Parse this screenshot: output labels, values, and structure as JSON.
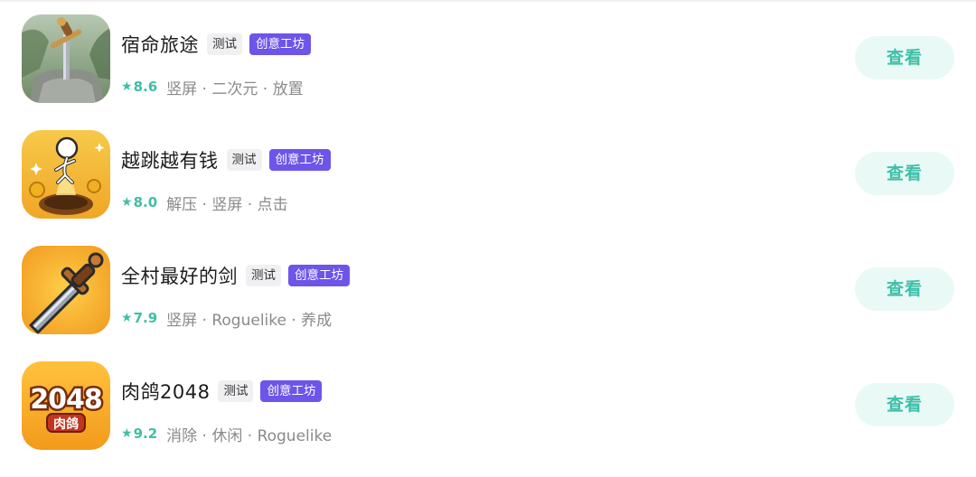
{
  "games": [
    {
      "name": "宿命旅途",
      "test_label": "测试",
      "workshop_label": "创意工坊",
      "rating": "8.6",
      "tags": "竖屏 · 二次元 · 放置",
      "button_label": "查看",
      "icon": "sword-in-stone-icon"
    },
    {
      "name": "越跳越有钱",
      "test_label": "测试",
      "workshop_label": "创意工坊",
      "rating": "8.0",
      "tags": "解压 · 竖屏 · 点击",
      "button_label": "查看",
      "icon": "jumping-figure-coins-icon"
    },
    {
      "name": "全村最好的剑",
      "test_label": "测试",
      "workshop_label": "创意工坊",
      "rating": "7.9",
      "tags": "竖屏 · Roguelike · 养成",
      "button_label": "查看",
      "icon": "sword-icon"
    },
    {
      "name": "肉鸽2048",
      "test_label": "测试",
      "workshop_label": "创意工坊",
      "rating": "9.2",
      "tags": "消除 · 休闲 · Roguelike",
      "button_label": "查看",
      "icon": "2048-logo-icon"
    }
  ],
  "icon_art": {
    "logo_2048": "2048",
    "logo_sub": "肉鸽"
  },
  "colors": {
    "accent_teal": "#3dbfa6",
    "workshop_purple": "#6d55ea",
    "button_bg": "#e9faf6"
  }
}
